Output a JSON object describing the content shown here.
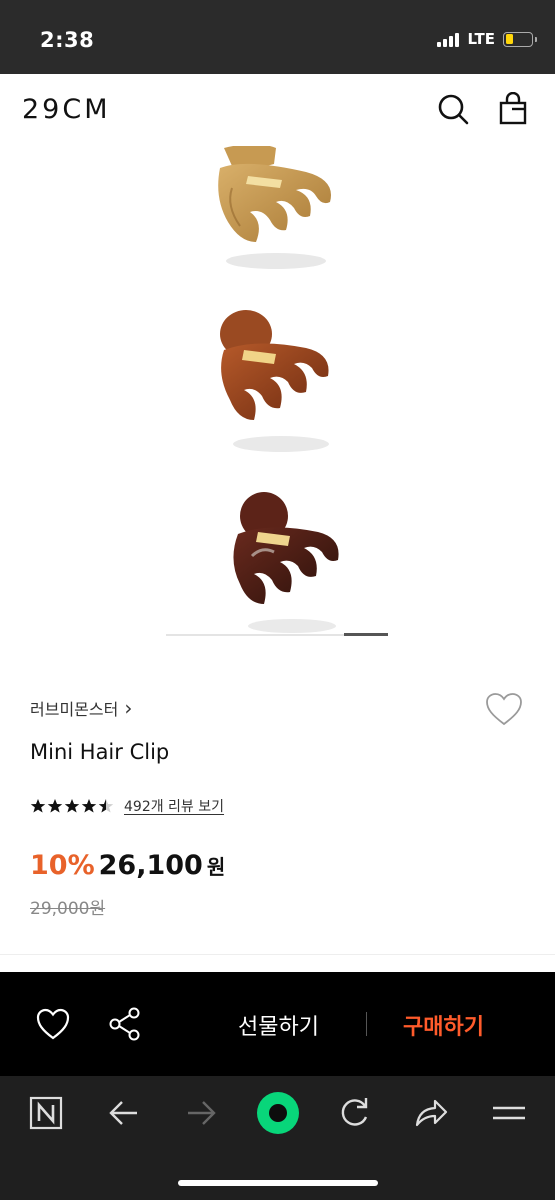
{
  "status_bar": {
    "time": "2:38",
    "network": "LTE",
    "battery_level": 0.3,
    "battery_color": "#ffd60a"
  },
  "header": {
    "logo": "29CM",
    "icons": [
      "search-icon",
      "shopping-bag-icon"
    ]
  },
  "gallery": {
    "image_count": 6,
    "current_index": 5,
    "images": [
      "hair-clip-honey",
      "hair-clip-amber",
      "hair-clip-tortoise"
    ]
  },
  "product": {
    "brand": "러브미몬스터",
    "brand_chevron": "›",
    "name": "Mini Hair Clip",
    "rating": 4.5,
    "reviews_link": "492개 리뷰 보기",
    "discount": "10%",
    "price": "26,100",
    "price_unit": "원",
    "original_price": "29,000원"
  },
  "action_bar": {
    "gift_label": "선물하기",
    "buy_label": "구매하기",
    "buy_color": "#ff5b2b",
    "icons": [
      "heart-icon",
      "share-icon"
    ]
  },
  "browser": {
    "icons": [
      "naver-n-icon",
      "back-arrow-icon",
      "forward-arrow-icon",
      "green-dot-icon",
      "reload-icon",
      "share-arrow-icon",
      "menu-icon"
    ],
    "accent": "#08d67a"
  },
  "colors": {
    "discount": "#e8622a",
    "status_bg": "#2b2b2b",
    "action_bg": "#000000",
    "browser_bg": "#1f1f1f"
  }
}
